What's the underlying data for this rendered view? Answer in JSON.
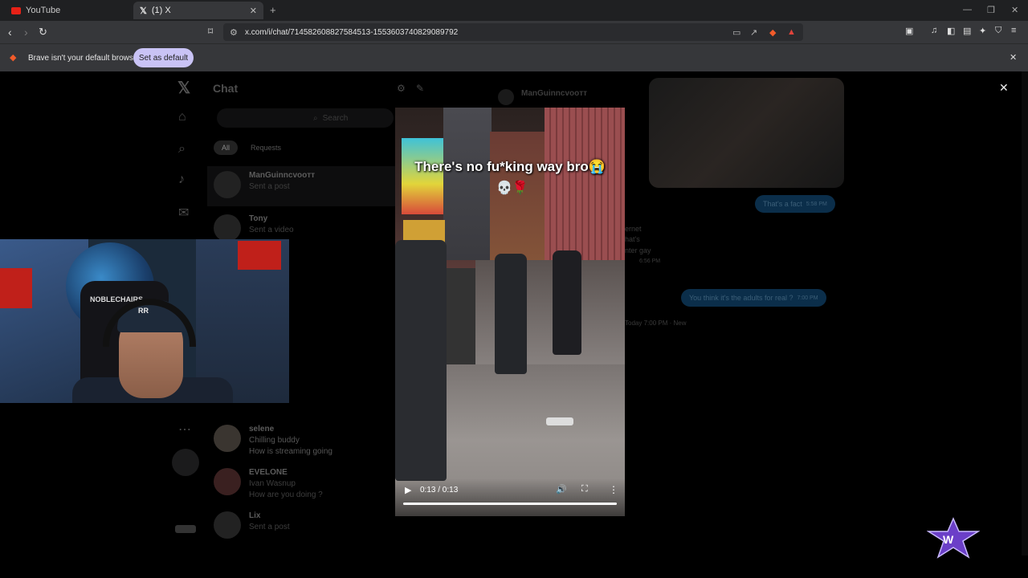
{
  "browser": {
    "tabs": [
      {
        "label": "YouTube",
        "favicon_color": "#e62117"
      },
      {
        "label": "(1) X",
        "favicon_color": "#ffffff"
      }
    ],
    "url": "x.com/i/chat/714582608827584513-1553603740829089792",
    "infobar": {
      "message": "Brave isn't your default browser",
      "button_label": "Set as default"
    }
  },
  "chat": {
    "title": "Chat",
    "search_placeholder": "Search",
    "filters": [
      "All",
      "Requests"
    ],
    "conversations": [
      {
        "name": "ManGuinncvooтт",
        "preview": "Sent a post",
        "preview2": ""
      },
      {
        "name": "Tony",
        "preview": "Sent a video",
        "preview2": ""
      },
      {
        "name": "selene",
        "preview": "Chilling buddy",
        "preview2": "How is streaming going"
      },
      {
        "name": "EVELONE",
        "preview": "Ivan Wasnup",
        "preview2": "How are you doing ?"
      },
      {
        "name": "Lix",
        "preview": "Sent a post",
        "preview2": ""
      }
    ],
    "header_name": "ManGuinncvooтт",
    "bubbles": [
      {
        "text": "That's a fact",
        "time": "5:58 PM"
      },
      {
        "text": "You think it's the adults for real ?",
        "time": "7:00 PM"
      }
    ],
    "divider": "Today 7:00 PM · New",
    "partial_text": [
      "ernet",
      "hat's",
      "nter gay",
      "6:56 PM"
    ]
  },
  "video": {
    "caption": "There's no fu*king way bro😭",
    "caption_emoji": "💀🌹",
    "time_display": "0:13 / 0:13",
    "progress": 1.0
  },
  "webcam": {
    "chair_text": "NOBLECHAIRS",
    "cap_logo": "RR"
  },
  "colors": {
    "accent": "#1d9bf0",
    "infobar_button": "#c9c3f5",
    "brand_logo": "#6b3fc8"
  }
}
